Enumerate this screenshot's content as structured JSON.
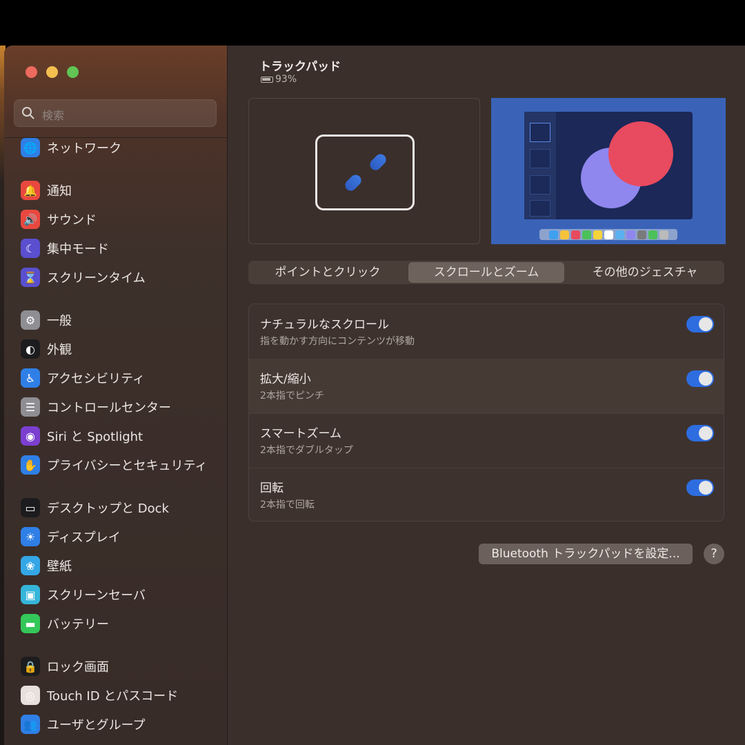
{
  "search": {
    "placeholder": "検索"
  },
  "sidebar": {
    "items": [
      {
        "label": "ネットワーク",
        "icon": "globe-icon",
        "glyph": "🌐",
        "color": "#2f7fe6"
      },
      {
        "label": "通知",
        "icon": "bell-icon",
        "glyph": "🔔",
        "color": "#e9483f"
      },
      {
        "label": "サウンド",
        "icon": "speaker-icon",
        "glyph": "🔊",
        "color": "#e9483f"
      },
      {
        "label": "集中モード",
        "icon": "moon-icon",
        "glyph": "☾",
        "color": "#5a4fcf"
      },
      {
        "label": "スクリーンタイム",
        "icon": "hourglass-icon",
        "glyph": "⌛",
        "color": "#5a4fcf"
      },
      {
        "label": "一般",
        "icon": "gear-icon",
        "glyph": "⚙",
        "color": "#8e8e93"
      },
      {
        "label": "外観",
        "icon": "appearance-icon",
        "glyph": "◐",
        "color": "#1c1c1e"
      },
      {
        "label": "アクセシビリティ",
        "icon": "accessibility-icon",
        "glyph": "♿",
        "color": "#2f7fe6"
      },
      {
        "label": "コントロールセンター",
        "icon": "control-center-icon",
        "glyph": "☰",
        "color": "#8e8e93"
      },
      {
        "label": "Siri と Spotlight",
        "icon": "siri-icon",
        "glyph": "◉",
        "color": "#7b3fd0"
      },
      {
        "label": "プライバシーとセキュリティ",
        "icon": "hand-icon",
        "glyph": "✋",
        "color": "#2f7fe6"
      },
      {
        "label": "デスクトップと Dock",
        "icon": "dock-icon",
        "glyph": "▭",
        "color": "#1c1c1e"
      },
      {
        "label": "ディスプレイ",
        "icon": "sun-icon",
        "glyph": "☀",
        "color": "#2f7fe6"
      },
      {
        "label": "壁紙",
        "icon": "wallpaper-icon",
        "glyph": "❀",
        "color": "#35a6e6"
      },
      {
        "label": "スクリーンセーバ",
        "icon": "screensaver-icon",
        "glyph": "▣",
        "color": "#35b5d9"
      },
      {
        "label": "バッテリー",
        "icon": "battery-icon",
        "glyph": "▬",
        "color": "#34c759"
      },
      {
        "label": "ロック画面",
        "icon": "lock-icon",
        "glyph": "🔒",
        "color": "#1c1c1e"
      },
      {
        "label": "Touch ID とパスコード",
        "icon": "fingerprint-icon",
        "glyph": "◎",
        "color": "#e8e0dc"
      },
      {
        "label": "ユーザとグループ",
        "icon": "users-icon",
        "glyph": "👥",
        "color": "#2f7fe6"
      }
    ]
  },
  "main": {
    "title": "トラックパッド",
    "battery": "93%",
    "tabs": [
      {
        "label": "ポイントとクリック"
      },
      {
        "label": "スクロールとズーム"
      },
      {
        "label": "その他のジェスチャ"
      }
    ],
    "settings": [
      {
        "title": "ナチュラルなスクロール",
        "subtitle": "指を動かす方向にコンテンツが移動",
        "on": true
      },
      {
        "title": "拡大/縮小",
        "subtitle": "2本指でピンチ",
        "on": true
      },
      {
        "title": "スマートズーム",
        "subtitle": "2本指でダブルタップ",
        "on": true
      },
      {
        "title": "回転",
        "subtitle": "2本指で回転",
        "on": true
      }
    ],
    "bluetooth_button": "Bluetooth トラックパッドを設定...",
    "help_button": "?"
  },
  "colors": {
    "accent": "#2e6de0",
    "background": "#3a2f2b"
  }
}
